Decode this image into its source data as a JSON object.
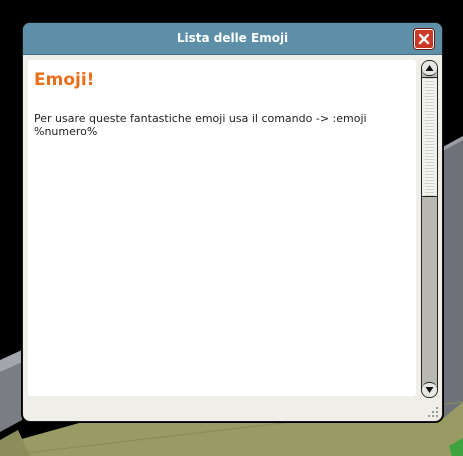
{
  "window": {
    "title": "Lista delle Emoji",
    "close_icon": "close-icon",
    "accent_color": "#5d8fa8",
    "close_color": "#c93a26"
  },
  "content": {
    "heading": "Emoji!",
    "heading_color": "#e96e1a",
    "body": "Per usare queste fantastiche emoji usa il comando -> :emoji %numero%"
  },
  "scrollbar": {
    "up_icon": "arrow-up-icon",
    "down_icon": "arrow-down-icon"
  }
}
